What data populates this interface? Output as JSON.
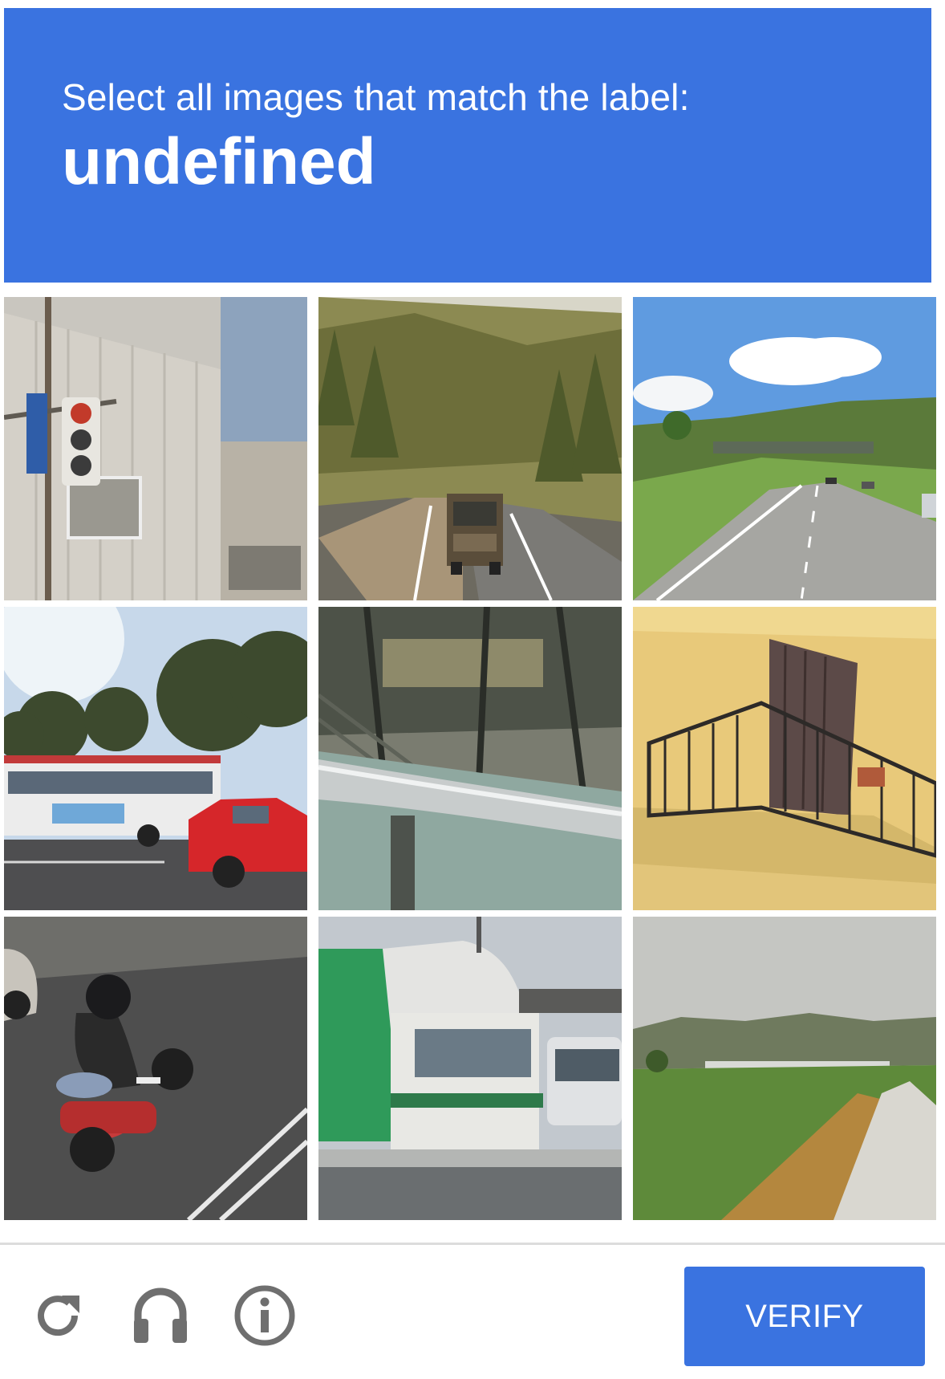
{
  "header": {
    "instruction": "Select all images that match the label:",
    "label": "undefined",
    "background_color": "#3a73e0"
  },
  "grid": {
    "rows": 3,
    "columns": 3,
    "tiles": [
      {
        "subject": "building with traffic light"
      },
      {
        "subject": "truck on forest road"
      },
      {
        "subject": "highway with overpass"
      },
      {
        "subject": "bus and red car"
      },
      {
        "subject": "stairway handrail"
      },
      {
        "subject": "balcony"
      },
      {
        "subject": "motorcycle"
      },
      {
        "subject": "truck"
      },
      {
        "subject": "bridge over field"
      }
    ]
  },
  "footer": {
    "icons": [
      "reload-icon",
      "audio-icon",
      "info-icon"
    ],
    "verify_label": "VERIFY",
    "button_color": "#3a73e0",
    "icon_color": "#6f6f6f"
  }
}
